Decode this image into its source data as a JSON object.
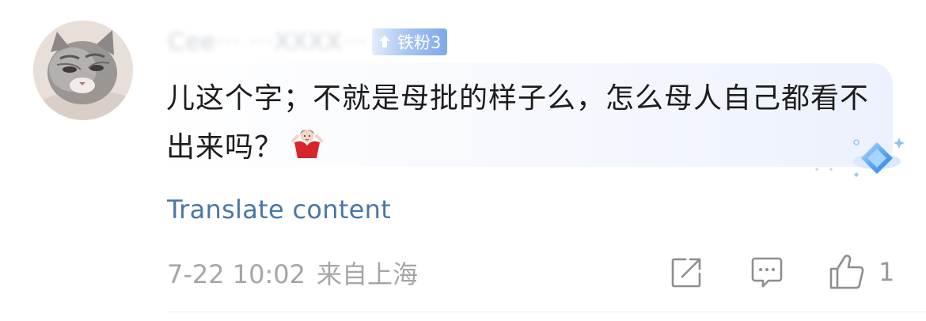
{
  "comment": {
    "username": "Cee··· ···XXXX···",
    "badge": {
      "icon": "fan-level-icon",
      "label": "铁粉3"
    },
    "text": "儿这个字；不就是母批的样子么，怎么母人自己都看不出来吗？",
    "emoji": "girl-emoji-icon",
    "translate_label": "Translate content",
    "timestamp": "7-22 10:02",
    "location": "来自上海",
    "like_count": "1"
  },
  "colors": {
    "link": "#4a76a8",
    "meta_text": "#a6a6a6",
    "body_text": "#1c1c1c",
    "badge_blue": "#7ea8ea",
    "bubble_tint": "#ecf1fd"
  }
}
